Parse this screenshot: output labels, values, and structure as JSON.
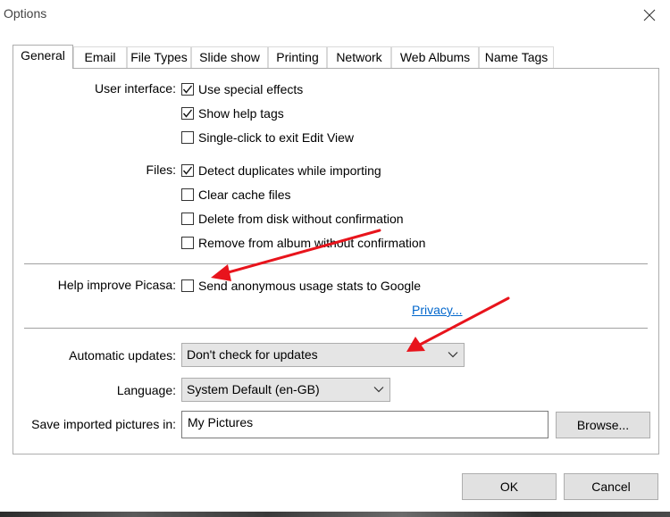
{
  "window": {
    "title": "Options"
  },
  "tabs": [
    {
      "label": "General",
      "active": true
    },
    {
      "label": "Email"
    },
    {
      "label": "File Types"
    },
    {
      "label": "Slide show"
    },
    {
      "label": "Printing"
    },
    {
      "label": "Network"
    },
    {
      "label": "Web Albums"
    },
    {
      "label": "Name Tags"
    }
  ],
  "user_interface": {
    "label": "User interface:",
    "options": [
      {
        "label": "Use special effects",
        "checked": true
      },
      {
        "label": "Show help tags",
        "checked": true
      },
      {
        "label": "Single-click to exit Edit View",
        "checked": false
      }
    ]
  },
  "files": {
    "label": "Files:",
    "options": [
      {
        "label": "Detect duplicates while importing",
        "checked": true
      },
      {
        "label": "Clear cache files",
        "checked": false
      },
      {
        "label": "Delete from disk without confirmation",
        "checked": false
      },
      {
        "label": "Remove from album without confirmation",
        "checked": false
      }
    ]
  },
  "help_improve": {
    "label": "Help improve Picasa:",
    "option": {
      "label": "Send anonymous usage stats to Google",
      "checked": false
    },
    "privacy_link": "Privacy..."
  },
  "automatic_updates": {
    "label": "Automatic updates:",
    "value": "Don't check for updates"
  },
  "language": {
    "label": "Language:",
    "value": "System Default (en-GB)"
  },
  "save_location": {
    "label": "Save imported pictures in:",
    "value": "My Pictures",
    "browse_label": "Browse..."
  },
  "footer": {
    "ok_label": "OK",
    "cancel_label": "Cancel"
  },
  "colors": {
    "annotation_arrow": "#e8141c",
    "link": "#0066cc"
  }
}
